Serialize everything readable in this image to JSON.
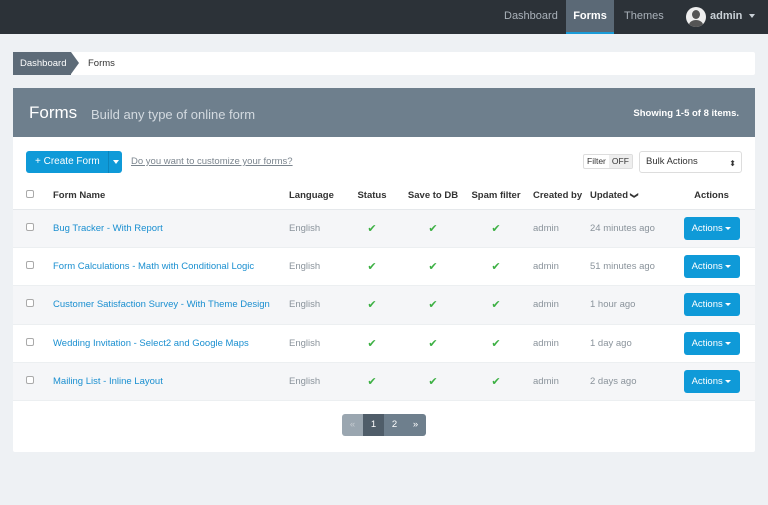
{
  "nav": {
    "items": [
      {
        "label": "Dashboard"
      },
      {
        "label": "Forms"
      },
      {
        "label": "Themes"
      }
    ],
    "user": "admin"
  },
  "breadcrumb": [
    "Dashboard",
    "Forms"
  ],
  "panel": {
    "title": "Forms",
    "subtitle": "Build any type of online form",
    "summary": "Showing 1-5 of 8 items."
  },
  "toolbar": {
    "create": "+ Create Form",
    "customize_link": "Do you want to customize your forms?",
    "filter_label": "Filter",
    "filter_state": "OFF",
    "bulk_actions": "Bulk Actions"
  },
  "columns": [
    "Form Name",
    "Language",
    "Status",
    "Save to DB",
    "Spam filter",
    "Created by",
    "Updated",
    "Actions"
  ],
  "rows": [
    {
      "name": "Bug Tracker - With Report",
      "language": "English",
      "created_by": "admin",
      "updated": "24 minutes ago",
      "action": "Actions"
    },
    {
      "name": "Form Calculations - Math with Conditional Logic",
      "language": "English",
      "created_by": "admin",
      "updated": "51 minutes ago",
      "action": "Actions"
    },
    {
      "name": "Customer Satisfaction Survey - With Theme Design",
      "language": "English",
      "created_by": "admin",
      "updated": "1 hour ago",
      "action": "Actions"
    },
    {
      "name": "Wedding Invitation - Select2 and Google Maps",
      "language": "English",
      "created_by": "admin",
      "updated": "1 day ago",
      "action": "Actions"
    },
    {
      "name": "Mailing List - Inline Layout",
      "language": "English",
      "created_by": "admin",
      "updated": "2 days ago",
      "action": "Actions"
    }
  ],
  "pagination": {
    "prev": "«",
    "pages": [
      "1",
      "2"
    ],
    "next": "»",
    "current": "1"
  }
}
